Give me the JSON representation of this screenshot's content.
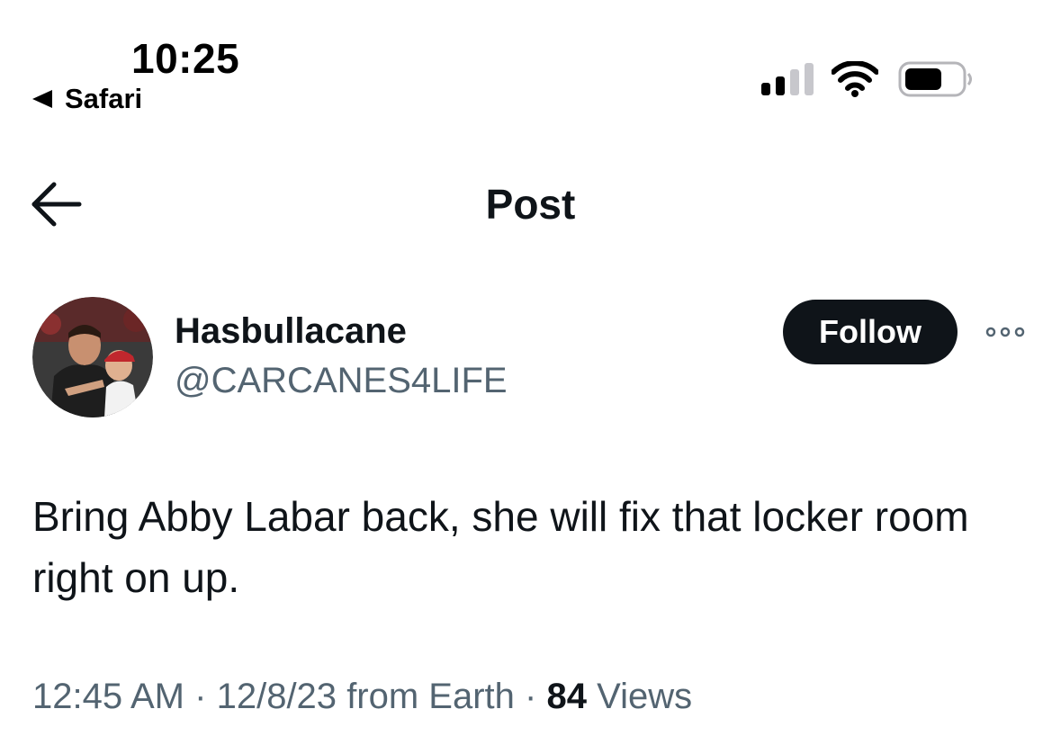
{
  "status_bar": {
    "time": "10:25",
    "back_app": "Safari",
    "icons": [
      "cellular-signal-icon",
      "wifi-icon",
      "battery-icon"
    ]
  },
  "header": {
    "title": "Post",
    "back_icon": "arrow-left-icon"
  },
  "author": {
    "display_name": "Hasbullacane",
    "handle": "@CARCANES4LIFE",
    "follow_label": "Follow",
    "more_icon": "more-horizontal-icon"
  },
  "post": {
    "text": "Bring Abby Labar back, she will fix that locker room right on up."
  },
  "meta": {
    "time": "12:45 AM",
    "separator": "·",
    "date": "12/8/23",
    "source": "from Earth",
    "views_count": "84",
    "views_label": "Views"
  },
  "colors": {
    "text_primary": "#0f1419",
    "text_secondary": "#536471",
    "button_bg": "#0f1419",
    "button_text": "#ffffff"
  }
}
